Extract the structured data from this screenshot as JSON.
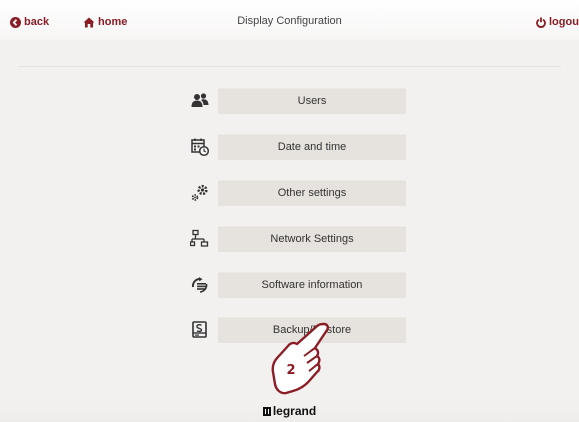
{
  "header": {
    "back_label": "back",
    "home_label": "home",
    "title": "Display Configuration",
    "logout_label": "logout"
  },
  "menu": {
    "items": [
      {
        "label": "Users",
        "icon": "users-icon"
      },
      {
        "label": "Date and time",
        "icon": "calendar-clock-icon"
      },
      {
        "label": "Other settings",
        "icon": "gears-icon"
      },
      {
        "label": "Network Settings",
        "icon": "network-icon"
      },
      {
        "label": "Software information",
        "icon": "software-info-icon"
      },
      {
        "label": "Backup/Restore",
        "icon": "backup-restore-icon"
      }
    ]
  },
  "annotation": {
    "step_number": "2"
  },
  "footer": {
    "brand": "legrand"
  },
  "colors": {
    "accent": "#8a1c25",
    "button_bg": "#e6e2dd",
    "background": "#f3f1ef"
  }
}
